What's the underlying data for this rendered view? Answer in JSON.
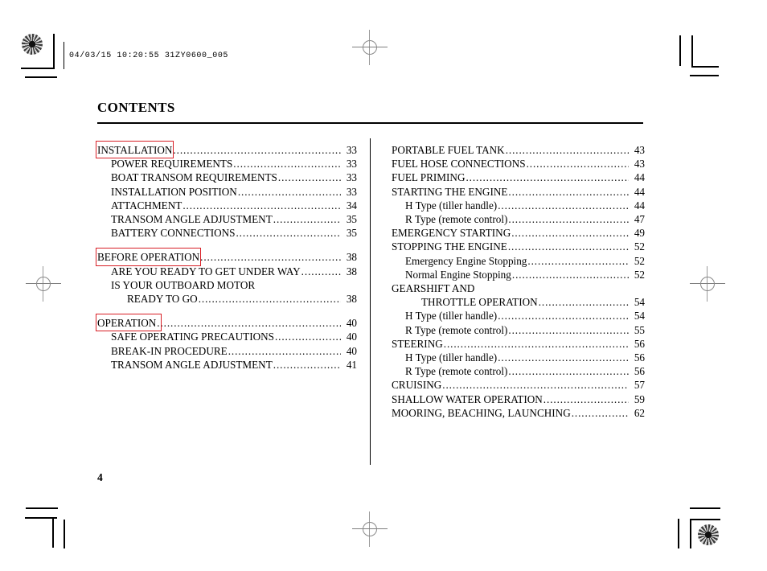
{
  "film_header": {
    "text": "04/03/15 10:20:55 31ZY0600_005"
  },
  "document": {
    "title": "CONTENTS",
    "page_number": "4",
    "accent_color": "#d81f26"
  },
  "left_column": [
    {
      "label": "INSTALLATION",
      "page": "33",
      "level": 0,
      "boxed": true,
      "dots": true
    },
    {
      "label": "POWER REQUIREMENTS",
      "page": "33",
      "level": 1,
      "boxed": false,
      "dots": true
    },
    {
      "label": "BOAT TRANSOM REQUIREMENTS",
      "page": "33",
      "level": 1,
      "boxed": false,
      "dots": true
    },
    {
      "label": "INSTALLATION POSITION",
      "page": "33",
      "level": 1,
      "boxed": false,
      "dots": true
    },
    {
      "label": "ATTACHMENT",
      "page": "34",
      "level": 1,
      "boxed": false,
      "dots": true
    },
    {
      "label": "TRANSOM ANGLE ADJUSTMENT",
      "page": "35",
      "level": 1,
      "boxed": false,
      "dots": true
    },
    {
      "label": "BATTERY CONNECTIONS",
      "page": "35",
      "level": 1,
      "boxed": false,
      "dots": true
    },
    {
      "label": "",
      "page": "",
      "level": 0,
      "spacer": true
    },
    {
      "label": "BEFORE OPERATION",
      "page": "38",
      "level": 0,
      "boxed": true,
      "dots": true
    },
    {
      "label": "ARE YOU READY TO GET UNDER WAY",
      "page": "38",
      "level": 1,
      "boxed": false,
      "dots": true
    },
    {
      "label": "IS YOUR OUTBOARD MOTOR",
      "page": "",
      "level": 1,
      "boxed": false,
      "dots": false
    },
    {
      "label": "READY TO GO",
      "page": "38",
      "level": 2,
      "boxed": false,
      "dots": true
    },
    {
      "label": "",
      "page": "",
      "level": 0,
      "spacer": true
    },
    {
      "label": "OPERATION",
      "page": "40",
      "level": 0,
      "boxed": true,
      "dots": true,
      "box_pad": true
    },
    {
      "label": "SAFE OPERATING PRECAUTIONS",
      "page": "40",
      "level": 1,
      "boxed": false,
      "dots": true
    },
    {
      "label": "BREAK-IN PROCEDURE",
      "page": "40",
      "level": 1,
      "boxed": false,
      "dots": true
    },
    {
      "label": "TRANSOM ANGLE ADJUSTMENT",
      "page": "41",
      "level": 1,
      "boxed": false,
      "dots": true
    }
  ],
  "right_column": [
    {
      "label": "PORTABLE FUEL TANK",
      "page": "43",
      "level": 0,
      "dots": true
    },
    {
      "label": "FUEL HOSE CONNECTIONS",
      "page": "43",
      "level": 0,
      "dots": true
    },
    {
      "label": "FUEL PRIMING",
      "page": "44",
      "level": 0,
      "dots": true
    },
    {
      "label": "STARTING THE ENGINE",
      "page": "44",
      "level": 0,
      "dots": true
    },
    {
      "label": "H Type (tiller handle)",
      "page": "44",
      "level": 1,
      "dots": true
    },
    {
      "label": "R Type (remote control)",
      "page": "47",
      "level": 1,
      "dots": true
    },
    {
      "label": "EMERGENCY STARTING",
      "page": "49",
      "level": 0,
      "dots": true
    },
    {
      "label": "STOPPING THE ENGINE",
      "page": "52",
      "level": 0,
      "dots": true
    },
    {
      "label": "Emergency Engine Stopping",
      "page": "52",
      "level": 1,
      "dots": true
    },
    {
      "label": "Normal Engine Stopping",
      "page": "52",
      "level": 1,
      "dots": true
    },
    {
      "label": "GEARSHIFT AND",
      "page": "",
      "level": 0,
      "dots": false
    },
    {
      "label": "THROTTLE OPERATION",
      "page": "54",
      "level": 2,
      "dots": true
    },
    {
      "label": "H Type (tiller handle)",
      "page": "54",
      "level": 1,
      "dots": true
    },
    {
      "label": "R Type (remote control)",
      "page": "55",
      "level": 1,
      "dots": true
    },
    {
      "label": "STEERING",
      "page": "56",
      "level": 0,
      "dots": true
    },
    {
      "label": "H Type (tiller handle)",
      "page": "56",
      "level": 1,
      "dots": true
    },
    {
      "label": "R Type (remote control)",
      "page": "56",
      "level": 1,
      "dots": true
    },
    {
      "label": "CRUISING",
      "page": "57",
      "level": 0,
      "dots": true
    },
    {
      "label": "SHALLOW WATER OPERATION",
      "page": "59",
      "level": 0,
      "dots": true
    },
    {
      "label": "MOORING, BEACHING, LAUNCHING",
      "page": "62",
      "level": 0,
      "dots": true
    }
  ]
}
